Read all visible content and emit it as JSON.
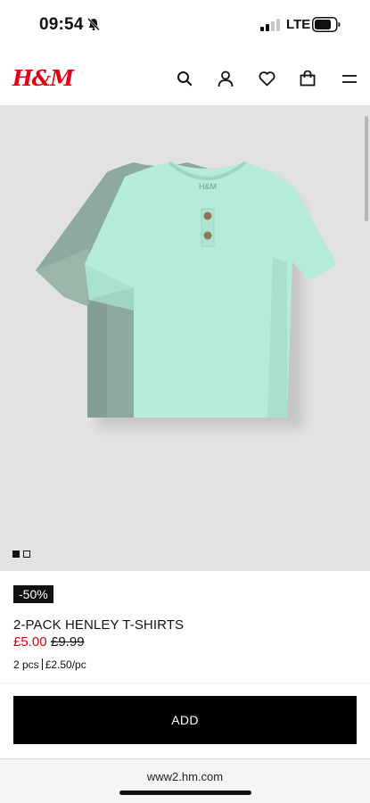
{
  "status_bar": {
    "time": "09:54",
    "network": "LTE",
    "bell_icon": "bell-slash-icon",
    "signal_icon": "signal-icon",
    "battery_icon": "battery-icon"
  },
  "header": {
    "logo_text": "H&M",
    "logo_color": "#e50010",
    "icons": [
      "search-icon",
      "account-icon",
      "heart-icon",
      "bag-icon",
      "menu-icon"
    ]
  },
  "product": {
    "image_background": "#e2e2e2",
    "image_description_icons": "tshirt-image",
    "carousel": {
      "total": 2,
      "active": 1
    },
    "discount_badge": "-50%",
    "name": "2-PACK HENLEY T-SHIRTS",
    "price_sale": "£5.00",
    "price_original": "£9.99",
    "price_sale_color": "#d3000b",
    "pack_count": "2 pcs",
    "price_per_piece": "£2.50/pc"
  },
  "actions": {
    "add_label": "ADD"
  },
  "browser": {
    "url": "www2.hm.com"
  }
}
